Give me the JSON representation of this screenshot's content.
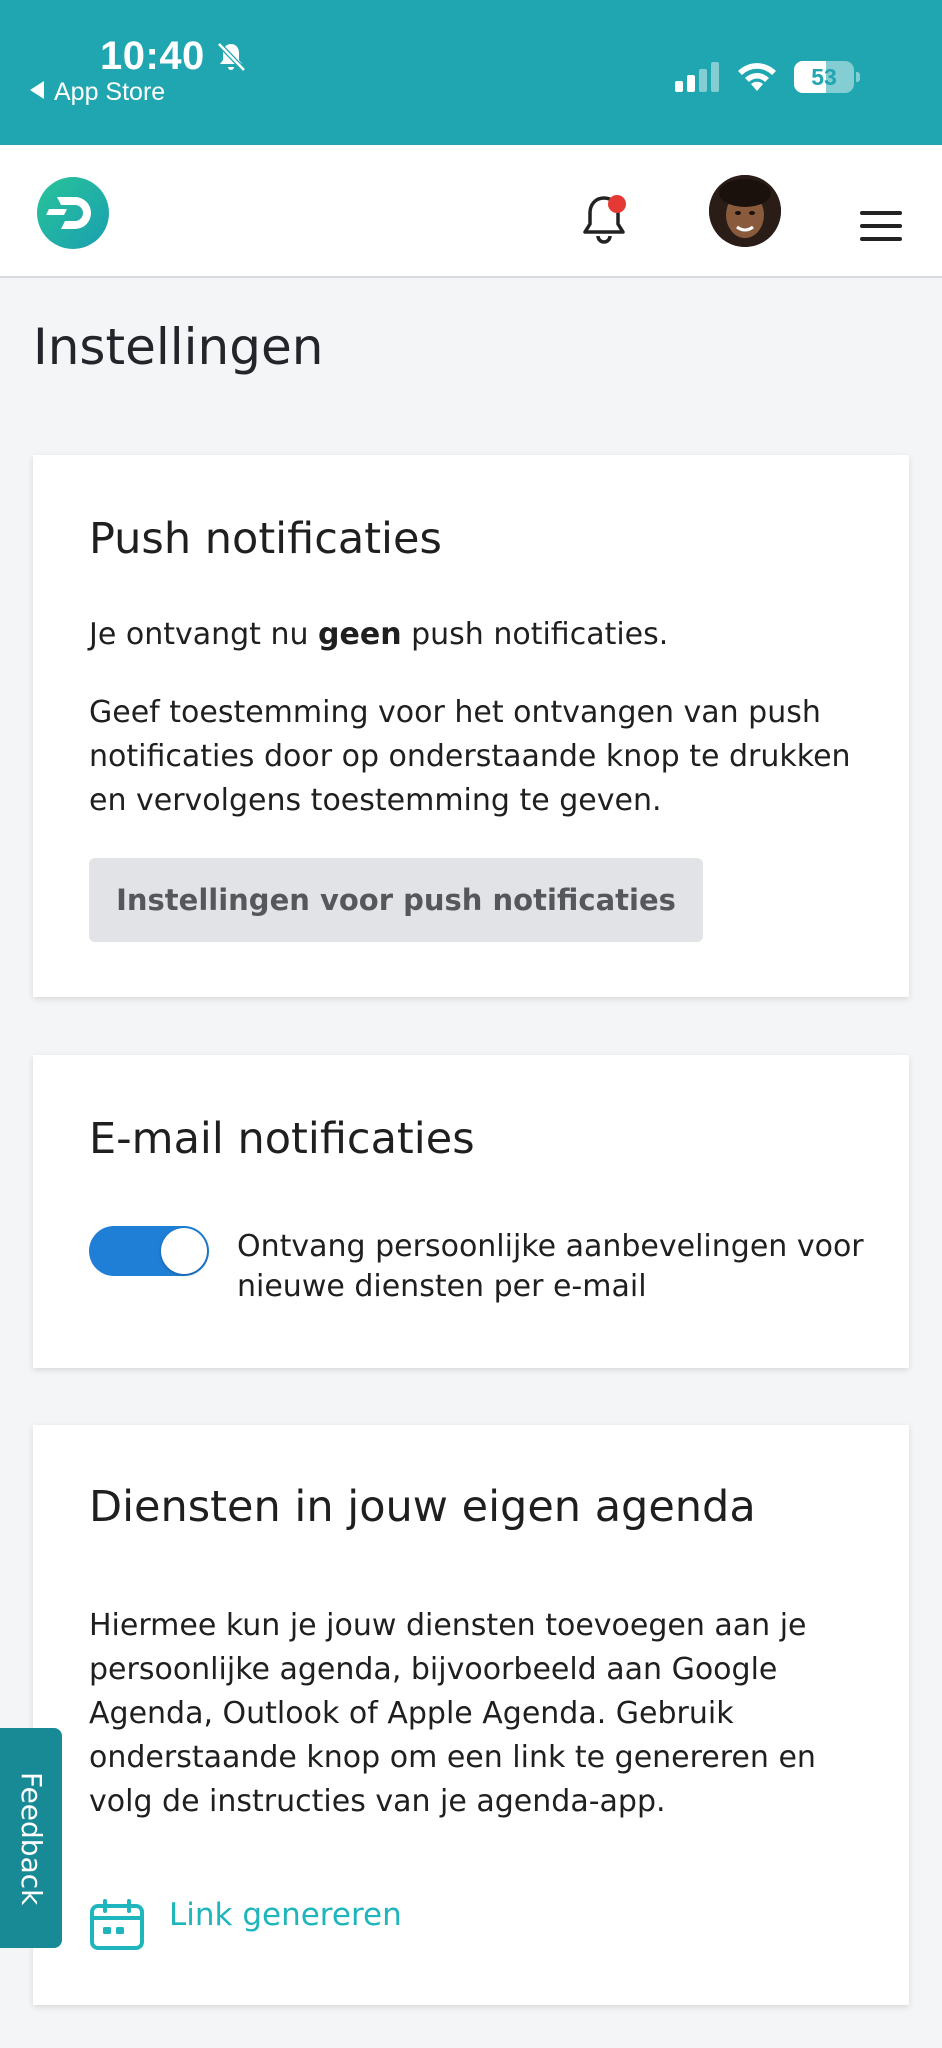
{
  "status_bar": {
    "time": "10:40",
    "back_label": "App Store",
    "battery_percent": 53,
    "battery_label": "53",
    "icons": [
      "bell-slash-icon",
      "signal-icon",
      "wifi-icon",
      "battery-icon"
    ]
  },
  "header": {
    "logo": "logo-d-icon",
    "notification_icon": "bell-icon",
    "has_unread_notifications": true,
    "menu_icon": "hamburger-menu-icon"
  },
  "page": {
    "title": "Instellingen"
  },
  "push": {
    "title": "Push notificaties",
    "status_prefix": "Je ontvangt nu ",
    "status_bold": "geen",
    "status_suffix": " push notificaties.",
    "description": "Geef toestemming voor het ontvangen van push notificaties door op onderstaande knop te drukken en vervolgens toestemming te geven.",
    "button_label": "Instellingen voor push notificaties"
  },
  "email": {
    "title": "E-mail notificaties",
    "toggle_on": true,
    "toggle_label": "Ontvang persoonlijke aanbevelingen voor nieuwe diensten per e-mail"
  },
  "agenda": {
    "title": "Diensten in jouw eigen agenda",
    "description": "Hiermee kun je jouw diensten toevoegen aan je persoonlijke agenda, bijvoorbeeld aan Google Agenda, Outlook of Apple Agenda. Gebruik onderstaande knop om een link te genereren en volg de instructies van je agenda-app.",
    "link_label": "Link genereren",
    "link_icon": "calendar-icon"
  },
  "feedback": {
    "label": "Feedback"
  },
  "colors": {
    "brand": "#1fa6b0",
    "accent_link": "#1fb5bd",
    "toggle": "#1f7fd6",
    "notification_dot": "#e53935"
  }
}
